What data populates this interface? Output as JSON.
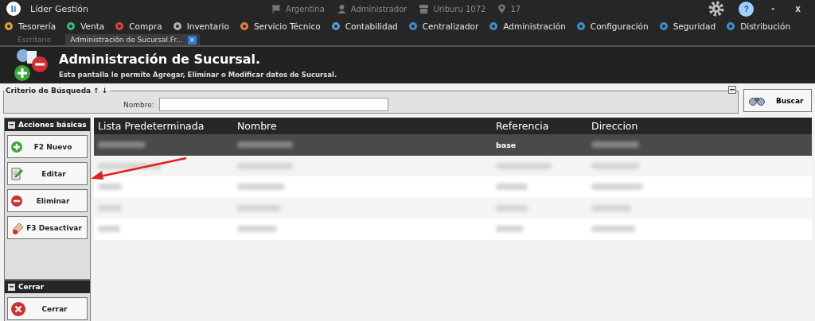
{
  "app": {
    "title": "Líder Gestión",
    "logo": "li",
    "status": [
      {
        "kind": "flag",
        "text": "Argentina"
      },
      {
        "kind": "user",
        "text": "Administrador"
      },
      {
        "kind": "store",
        "text": "Uriburu 1072"
      },
      {
        "kind": "pin",
        "text": "17"
      }
    ],
    "help": "?",
    "minimize": "-",
    "close": "x"
  },
  "menu": [
    {
      "label": "Tesorería",
      "color": "#e0a040"
    },
    {
      "label": "Venta",
      "color": "#3cb878"
    },
    {
      "label": "Compra",
      "color": "#e04040"
    },
    {
      "label": "Inventario",
      "color": "#b0b0b0"
    },
    {
      "label": "Servicio Técnico",
      "color": "#e08040"
    },
    {
      "label": "Contabilidad",
      "color": "#5b9bd5"
    },
    {
      "label": "Centralizador",
      "color": "#3a8fd0"
    },
    {
      "label": "Administración",
      "color": "#3a8fd0"
    },
    {
      "label": "Configuración",
      "color": "#3a8fd0"
    },
    {
      "label": "Seguridad",
      "color": "#3a8fd0"
    },
    {
      "label": "Distribución",
      "color": "#3a8fd0"
    }
  ],
  "tabs": [
    {
      "label": "Escritorio",
      "selected": false
    },
    {
      "label": "Administración de Sucursal.Fr...",
      "selected": true,
      "close": "×"
    }
  ],
  "header": {
    "title": "Administración de Sucursal.",
    "subtitle": "Esta pantalla le permite Agregar, Eliminar o Modificar datos de Sucursal."
  },
  "search": {
    "legend": "Criterio de Búsqueda ↑ ↓",
    "field_label": "Nombre:",
    "button": "Buscar"
  },
  "panels": [
    {
      "title": "Acciones básicas",
      "buttons": [
        {
          "kind": "add",
          "label": "F2 Nuevo"
        },
        {
          "kind": "edit",
          "label": "Editar"
        },
        {
          "kind": "delete",
          "label": "Eliminar"
        },
        {
          "kind": "deactivate",
          "label": "F3 Desactivar"
        }
      ]
    },
    {
      "title": "Cerrar",
      "buttons": [
        {
          "kind": "close",
          "label": "Cerrar"
        }
      ]
    }
  ],
  "table": {
    "columns": [
      "Lista Predeterminada",
      "Nombre",
      "Referencia",
      "Direccion"
    ],
    "rows": [
      {
        "selected": true,
        "referencia": "base"
      },
      {
        "selected": false
      },
      {
        "selected": false
      },
      {
        "selected": false
      },
      {
        "selected": false
      }
    ]
  }
}
